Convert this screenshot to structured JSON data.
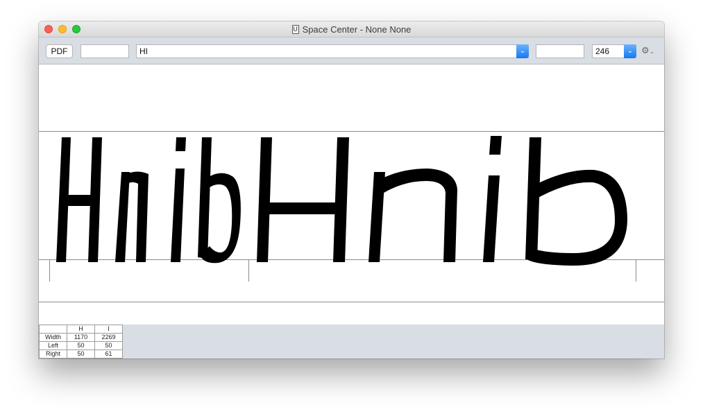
{
  "window": {
    "title": "Space Center - None None",
    "doc_icon": "U"
  },
  "toolbar": {
    "pdf_label": "PDF",
    "field_left_value": "",
    "text_value": "HI",
    "field_right_value": "",
    "size_value": "246",
    "gear_icon": "⚙",
    "gear_chevron": "⌄"
  },
  "metrics": {
    "columns": [
      "",
      "H",
      "I"
    ],
    "rows": [
      {
        "label": "Width",
        "H": "1170",
        "I": "2269"
      },
      {
        "label": "Left",
        "H": "50",
        "I": "50"
      },
      {
        "label": "Right",
        "H": "50",
        "I": "61"
      }
    ]
  },
  "colors": {
    "toolbar_bg": "#d9dde4",
    "combo_accent": "#1677f0",
    "glyph": "#000000"
  },
  "icons": [
    "close-light",
    "minimize-light",
    "zoom-light",
    "document-icon",
    "chevron-down-icon",
    "gear-icon"
  ]
}
